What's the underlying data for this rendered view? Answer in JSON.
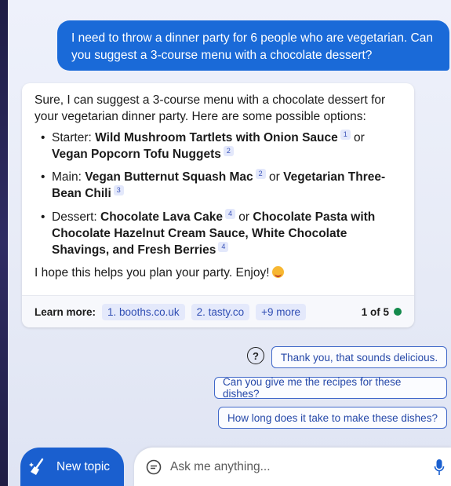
{
  "user_message": "I need to throw a dinner party for 6 people who are vegetarian. Can you suggest a 3-course menu with a chocolate dessert?",
  "bot": {
    "intro": "Sure, I can suggest a 3-course menu with a chocolate dessert for your vegetarian dinner party. Here are some possible options:",
    "options": [
      {
        "prefix": "Starter: ",
        "a": "Wild Mushroom Tartlets with Onion Sauce",
        "a_cite": "1",
        "or": " or ",
        "b": "Vegan Popcorn Tofu Nuggets",
        "b_cite": "2"
      },
      {
        "prefix": "Main: ",
        "a": "Vegan Butternut Squash Mac",
        "a_cite": "2",
        "or": " or ",
        "b": "Vegetarian Three-Bean Chili",
        "b_cite": "3"
      },
      {
        "prefix": "Dessert: ",
        "a": "Chocolate Lava Cake",
        "a_cite": "4",
        "or": " or ",
        "b": "Chocolate Pasta with Chocolate Hazelnut Cream Sauce, White Chocolate Shavings, and Fresh Berries",
        "b_cite": "4"
      }
    ],
    "closing": "I hope this helps you plan your party. Enjoy!",
    "emoji_icon": "smiling-face-icon"
  },
  "learn_more": {
    "label": "Learn more:",
    "chips": [
      "1. booths.co.uk",
      "2. tasty.co",
      "+9 more"
    ],
    "pager": "1 of 5"
  },
  "suggestions": [
    "Thank you, that sounds delicious.",
    "Can you give me the recipes for these dishes?",
    "How long does it take to make these dishes?"
  ],
  "help_icon_glyph": "?",
  "new_topic_label": "New topic",
  "ask_placeholder": "Ask me anything...",
  "colors": {
    "accent": "#1a6ad8",
    "status_dot": "#138a4c"
  }
}
